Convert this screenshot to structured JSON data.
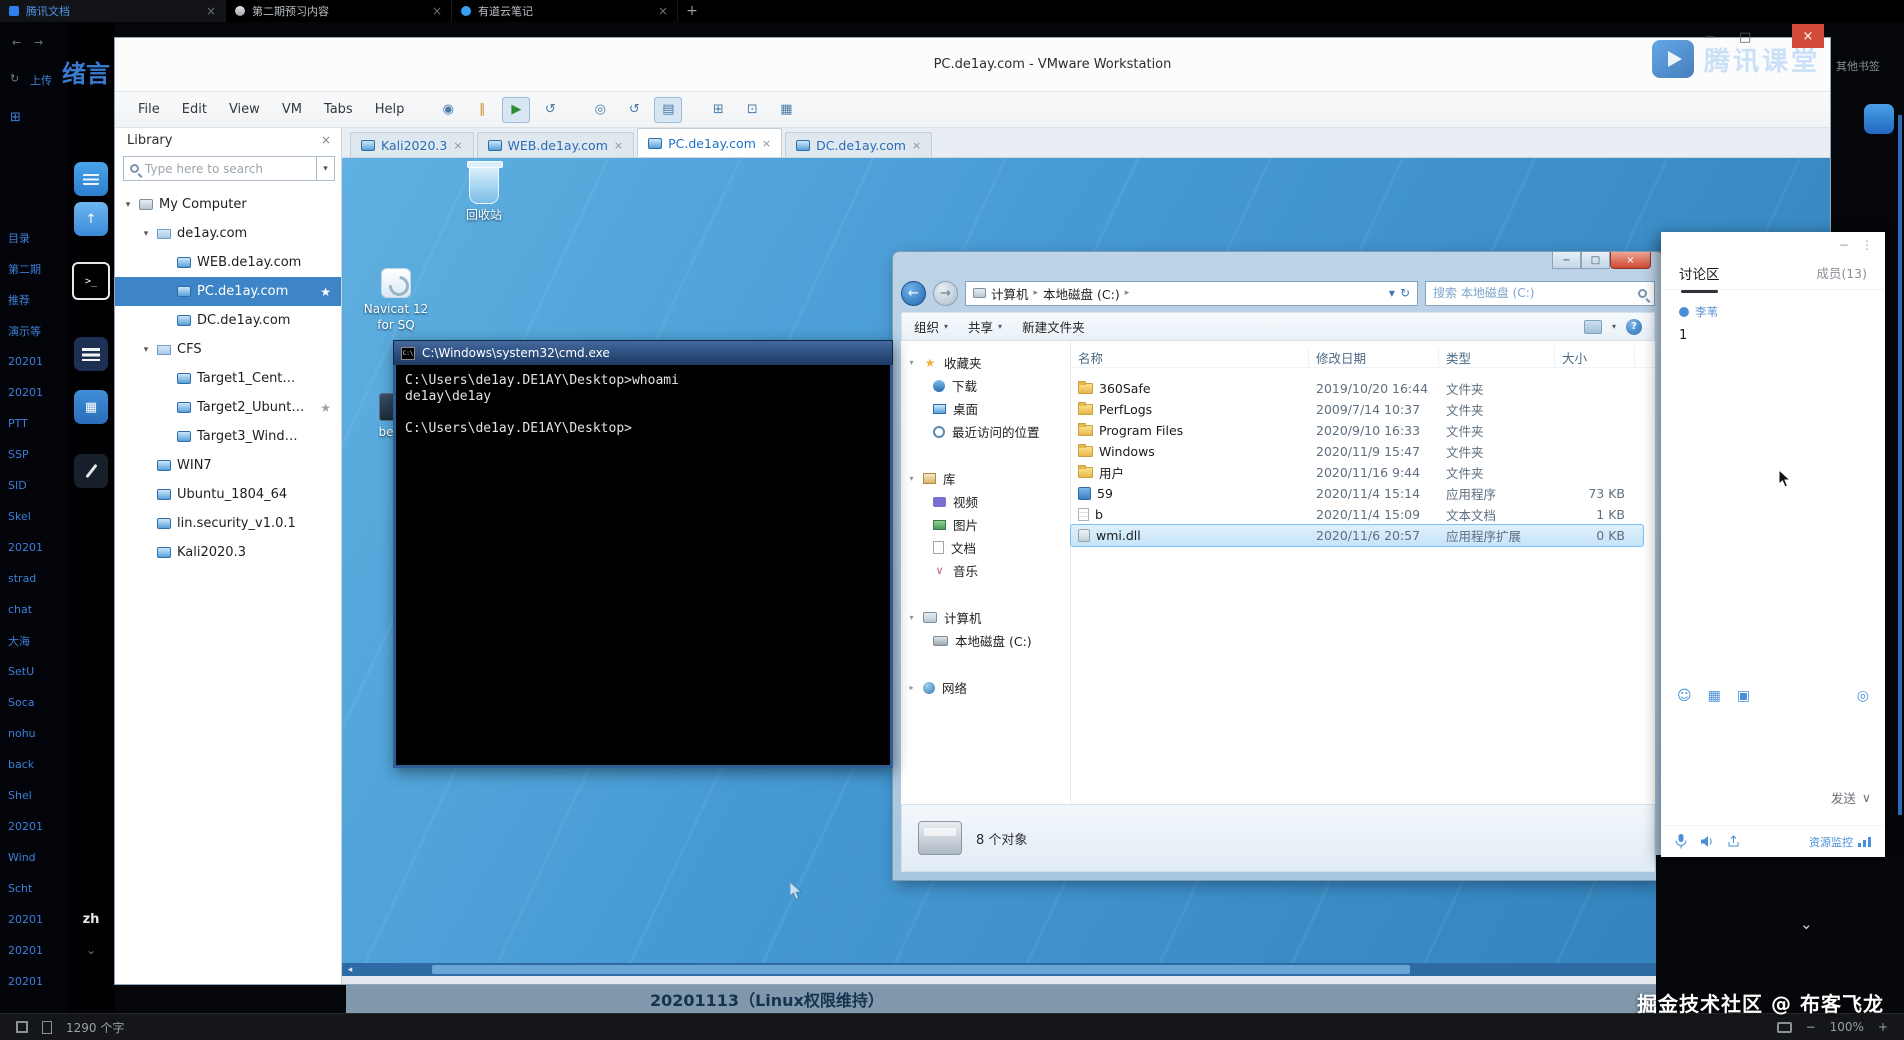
{
  "icons": {
    "close": "×",
    "caret_down": "▾",
    "caret_right": "▸",
    "chevron_down": "⌄",
    "chevron_left": "◂",
    "chevron_right": "▸",
    "back": "←",
    "forward": "→",
    "refresh": "↻",
    "up": "↑",
    "dots": "⋮",
    "minus": "−",
    "plus": "+",
    "star": "★",
    "help": "?",
    "prompt": ">_",
    "cmd_badge": "C:\\",
    "power": "◉",
    "suspend": "∥",
    "play": "▶",
    "reset": "↺",
    "snapshot": "◎",
    "manage": "▤",
    "grid": "⊞",
    "boxed": "⊡",
    "panes": "▦",
    "image": "▣",
    "smiley": "☺",
    "gear": "◎",
    "send_caret": "∨",
    "maximize": "□"
  },
  "browser": {
    "tab1": "腾讯文档",
    "tab2": "第二期预习内容",
    "tab3": "有道云笔记",
    "other_bookmarks": "其他书签"
  },
  "left": {
    "heading": "绪言",
    "upload": "上传",
    "ime": "zh",
    "notes": [
      "目录",
      "第二期",
      "推荐",
      "演示等",
      "20201",
      "20201",
      "PTT",
      "SSP",
      "SID",
      "Skel",
      "20201",
      "strad",
      "chat",
      "大海",
      "SetU",
      "Soca",
      "nohu",
      "back",
      "Shel",
      "20201",
      "Wind",
      "Scht",
      "20201",
      "20201",
      "20201"
    ]
  },
  "vmware": {
    "title": "PC.de1ay.com - VMware Workstation",
    "menus": [
      "File",
      "Edit",
      "View",
      "VM",
      "Tabs",
      "Help"
    ],
    "library": {
      "title": "Library",
      "search_placeholder": "Type here to search",
      "items": [
        "My Computer",
        "de1ay.com",
        "WEB.de1ay.com",
        "PC.de1ay.com",
        "DC.de1ay.com",
        "CFS",
        "Target1_Cent…",
        "Target2_Ubunt…",
        "Target3_Wind…",
        "WIN7",
        "Ubuntu_1804_64",
        "lin.security_v1.0.1",
        "Kali2020.3"
      ]
    },
    "tabs": [
      "Kali2020.3",
      "WEB.de1ay.com",
      "PC.de1ay.com",
      "DC.de1ay.com"
    ]
  },
  "desktop": {
    "recycle": "回收站",
    "navicat_line1": "Navicat 12",
    "navicat_line2": "for SQ",
    "beacon": "beac"
  },
  "cmd": {
    "title": "C:\\Windows\\system32\\cmd.exe",
    "lines": [
      "C:\\Users\\de1ay.DE1AY\\Desktop>whoami",
      "de1ay\\de1ay",
      "",
      "C:\\Users\\de1ay.DE1AY\\Desktop>"
    ]
  },
  "explorer": {
    "crumb_computer": "计算机",
    "crumb_disk": "本地磁盘 (C:)",
    "search_placeholder": "搜索 本地磁盘 (C:)",
    "organize": "组织",
    "share": "共享",
    "new_folder": "新建文件夹",
    "nav": {
      "favorites": "收藏夹",
      "downloads": "下载",
      "desktop": "桌面",
      "recent": "最近访问的位置",
      "libraries": "库",
      "videos": "视频",
      "pictures": "图片",
      "documents": "文档",
      "music": "音乐",
      "computer": "计算机",
      "disk_c": "本地磁盘 (C:)",
      "network": "网络"
    },
    "columns": [
      "名称",
      "修改日期",
      "类型",
      "大小"
    ],
    "files": [
      {
        "name": "360Safe",
        "date": "2019/10/20 16:44",
        "type": "文件夹",
        "size": ""
      },
      {
        "name": "PerfLogs",
        "date": "2009/7/14 10:37",
        "type": "文件夹",
        "size": ""
      },
      {
        "name": "Program Files",
        "date": "2020/9/10 16:33",
        "type": "文件夹",
        "size": ""
      },
      {
        "name": "Windows",
        "date": "2020/11/9 15:47",
        "type": "文件夹",
        "size": ""
      },
      {
        "name": "用户",
        "date": "2020/11/16 9:44",
        "type": "文件夹",
        "size": ""
      },
      {
        "name": "59",
        "date": "2020/11/4 15:14",
        "type": "应用程序",
        "size": "73 KB"
      },
      {
        "name": "b",
        "date": "2020/11/4 15:09",
        "type": "文本文档",
        "size": "1 KB"
      },
      {
        "name": "wmi.dll",
        "date": "2020/11/6 20:57",
        "type": "应用程序扩展",
        "size": "0 KB"
      }
    ],
    "status": "8 个对象"
  },
  "classroom": {
    "watermark": "腾讯课堂",
    "chat_tab": "讨论区",
    "members_tab": "成员(13)",
    "sender": "李苇",
    "message": "1",
    "send": "发送",
    "monitor": "资源监控"
  },
  "page": {
    "heading": "20201113（Linux权限维持）"
  },
  "statusbar": {
    "words": "1290 个字",
    "zoom": "100%"
  },
  "footer_watermark": "掘金技术社区 @ 布客飞龙"
}
